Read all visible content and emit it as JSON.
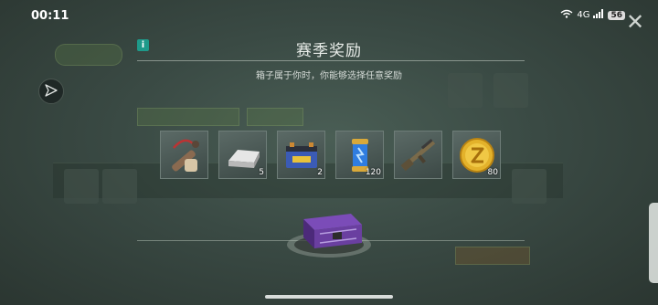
{
  "status_bar": {
    "time": "00:11",
    "network": "4G",
    "battery": "56"
  },
  "dialog": {
    "info_label": "i",
    "title": "赛季奖励",
    "subtitle": "箱子属于你时，你能够选择任意奖励",
    "close_symbol": "✕"
  },
  "rewards": [
    {
      "icon": "rocket-launcher-icon",
      "quantity": ""
    },
    {
      "icon": "metal-ingot-icon",
      "quantity": "5"
    },
    {
      "icon": "car-battery-icon",
      "quantity": "2"
    },
    {
      "icon": "energy-capsule-icon",
      "quantity": "120"
    },
    {
      "icon": "assault-rifle-icon",
      "quantity": ""
    },
    {
      "icon": "gold-coin-icon",
      "quantity": "80"
    }
  ],
  "chest": {
    "icon": "purple-chest-icon"
  },
  "colors": {
    "accent": "#1e9a8a",
    "coin": "#e3b22b",
    "chest": "#6a3fa0"
  }
}
